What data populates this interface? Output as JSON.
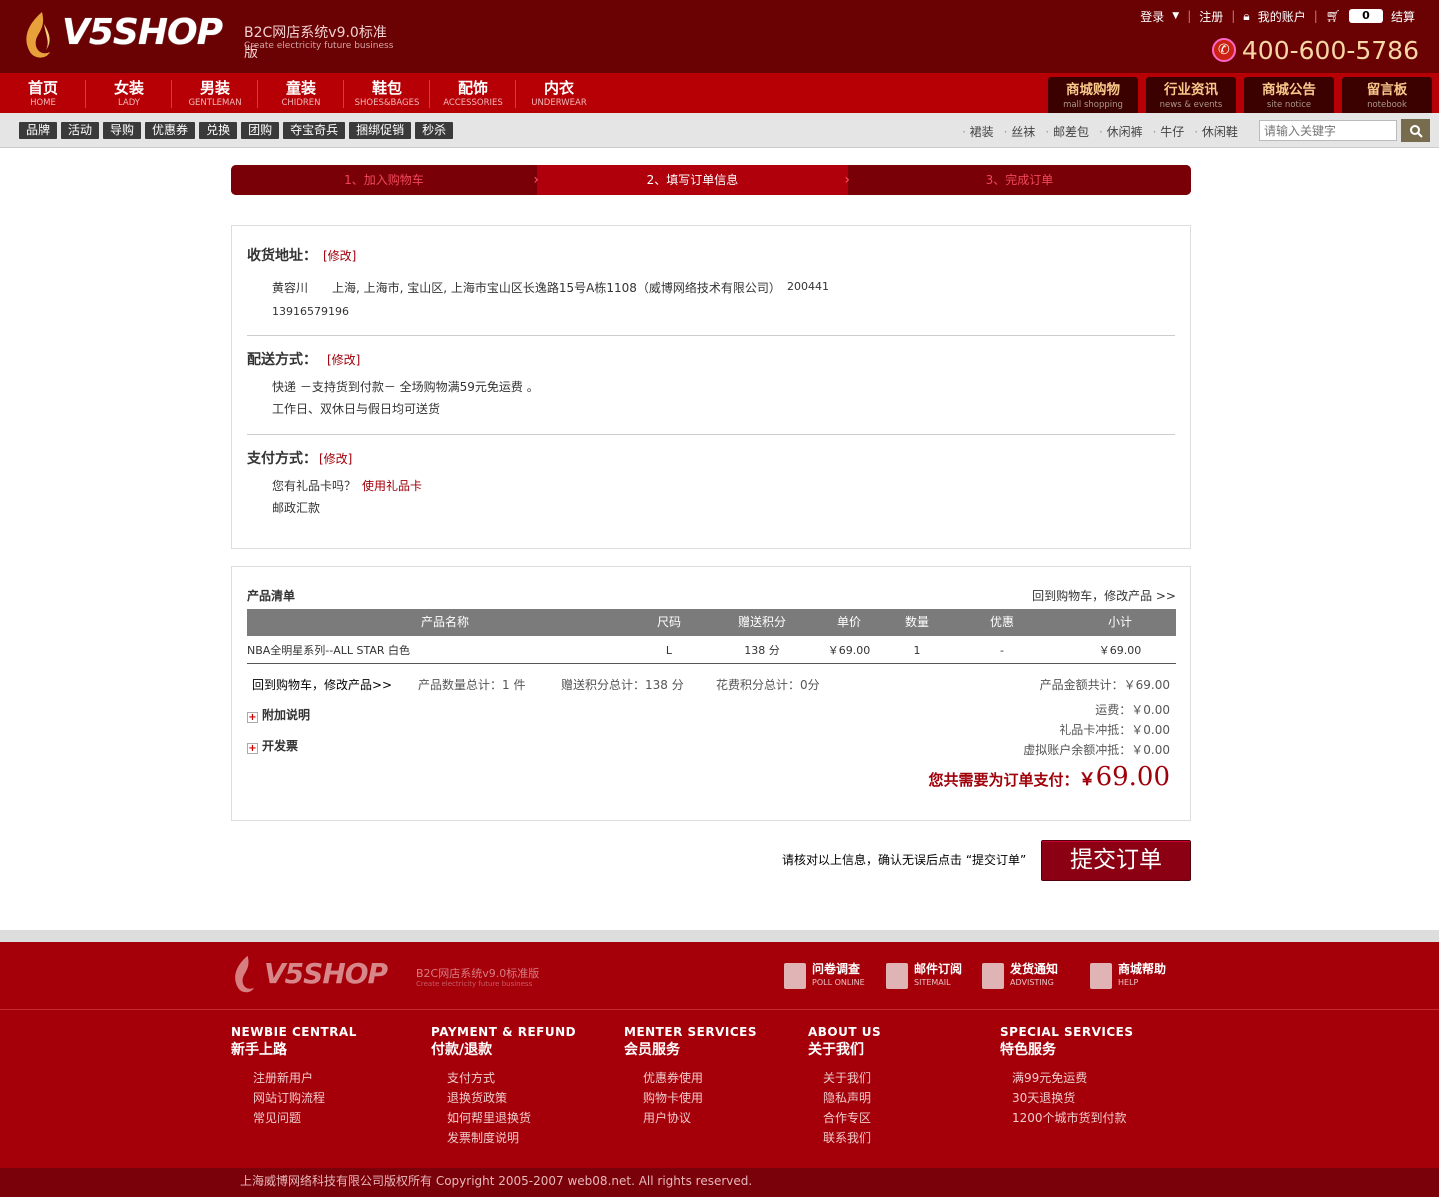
{
  "header": {
    "logo_text": "V5SHOP",
    "logo_subtitle": "B2C网店系统v9.0标准版",
    "logo_tagline": "Create electricity future business",
    "login": "登录",
    "register": "注册",
    "my_account": "我的账户",
    "cart_count": "0",
    "checkout": "结算",
    "phone": "400-600-5786"
  },
  "nav": {
    "items": [
      {
        "cn": "首页",
        "en": "HOME"
      },
      {
        "cn": "女装",
        "en": "LADY"
      },
      {
        "cn": "男装",
        "en": "GENTLEMAN"
      },
      {
        "cn": "童装",
        "en": "CHIDREN"
      },
      {
        "cn": "鞋包",
        "en": "SHOES&BAGES"
      },
      {
        "cn": "配饰",
        "en": "ACCESSORIES"
      },
      {
        "cn": "内衣",
        "en": "UNDERWEAR"
      }
    ],
    "tabs": [
      {
        "cn": "商城购物",
        "en": "mall shopping"
      },
      {
        "cn": "行业资讯",
        "en": "news & events"
      },
      {
        "cn": "商城公告",
        "en": "site notice"
      },
      {
        "cn": "留言板",
        "en": "notebook"
      }
    ]
  },
  "subbar": {
    "tags": [
      "品牌",
      "活动",
      "导购",
      "优惠券",
      "兑换",
      "团购",
      "夺宝奇兵",
      "捆绑促销",
      "秒杀"
    ],
    "hot": [
      "裙装",
      "丝袜",
      "邮差包",
      "休闲裤",
      "牛仔",
      "休闲鞋"
    ],
    "search_placeholder": "请输入关键字"
  },
  "steps": [
    "1、加入购物车",
    "2、填写订单信息",
    "3、完成订单"
  ],
  "address": {
    "title": "收货地址：",
    "edit": "[修改]",
    "name": "黄容川",
    "addr": "上海, 上海市, 宝山区, 上海市宝山区长逸路15号A栋1108（威博网络技术有限公司）",
    "zip": "200441",
    "phone": "13916579196"
  },
  "shipping": {
    "title": "配送方式：",
    "edit": "[修改]",
    "line1": "快递 －支持货到付款－ 全场购物满59元免运费 。",
    "line2": "工作日、双休日与假日均可送货"
  },
  "payment": {
    "title": "支付方式：",
    "edit": "[修改]",
    "giftcard_q": "您有礼品卡吗？",
    "giftcard_link": "使用礼品卡",
    "method": "邮政汇款"
  },
  "products": {
    "title": "产品清单",
    "back_link": "回到购物车，修改产品 >>",
    "headers": [
      "产品名称",
      "尺码",
      "赠送积分",
      "单价",
      "数量",
      "优惠",
      "小计"
    ],
    "rows": [
      {
        "name": "NBA全明星系列--ALL STAR 白色",
        "size": "L",
        "points": "138 分",
        "price": "￥69.00",
        "qty": "1",
        "discount": "-",
        "subtotal": "￥69.00"
      }
    ],
    "summary_back": "回到购物车，修改产品>>",
    "qty_total": "产品数量总计：1 件",
    "points_total": "赠送积分总计：138 分",
    "spent_points": "花费积分总计：0分",
    "amount_total": "产品金额共计：￥69.00",
    "extra_note": "附加说明",
    "invoice": "开发票",
    "freight": "运费：￥0.00",
    "gift_deduct": "礼品卡冲抵：￥0.00",
    "balance_deduct": "虚拟账户余额冲抵：￥0.00",
    "pay_label": "您共需要为订单支付：",
    "pay_currency": "￥",
    "pay_amount": "69.00"
  },
  "submit": {
    "tip": "请核对以上信息，确认无误后点击 “提交订单”",
    "button": "提交订单"
  },
  "footer": {
    "logo_text": "V5SHOP",
    "logo_subtitle": "B2C网店系统v9.0标准版",
    "logo_tagline": "Create electricity future business",
    "services": [
      {
        "cn": "问卷调查",
        "en": "POLL ONLINE"
      },
      {
        "cn": "邮件订阅",
        "en": "SITEMAIL"
      },
      {
        "cn": "发货通知",
        "en": "ADVISTING"
      },
      {
        "cn": "商城帮助",
        "en": "HELP"
      }
    ],
    "columns": [
      {
        "en": "NEWBIE CENTRAL",
        "cn": "新手上路",
        "links": [
          "注册新用户",
          "网站订购流程",
          "常见问题"
        ]
      },
      {
        "en": "PAYMENT & REFUND",
        "cn": "付款/退款",
        "links": [
          "支付方式",
          "退换货政策",
          "如何帮里退换货",
          "发票制度说明"
        ]
      },
      {
        "en": "MENTER SERVICES",
        "cn": "会员服务",
        "links": [
          "优惠券使用",
          "购物卡使用",
          "用户协议"
        ]
      },
      {
        "en": "ABOUT US",
        "cn": "关于我们",
        "links": [
          "关于我们",
          "隐私声明",
          "合作专区",
          "联系我们"
        ]
      },
      {
        "en": "SPECIAL SERVICES",
        "cn": "特色服务",
        "links": [
          "满99元免运费",
          "30天退换货",
          "1200个城市货到付款"
        ]
      }
    ],
    "copyright": "上海威博网络科技有限公司版权所有  Copyright 2005-2007 web08.net. All rights reserved."
  }
}
